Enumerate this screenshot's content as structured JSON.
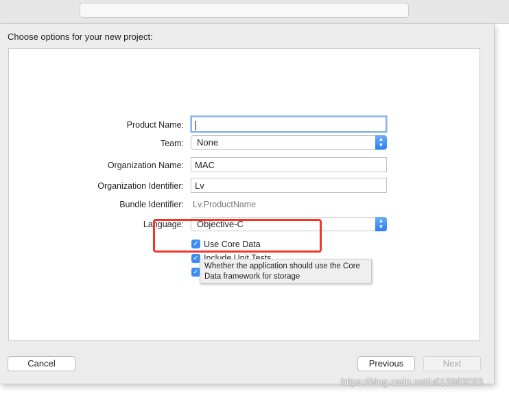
{
  "heading": "Choose options for your new project:",
  "form": {
    "product_name": {
      "label": "Product Name:",
      "value": ""
    },
    "team": {
      "label": "Team:",
      "value": "None"
    },
    "organization_name": {
      "label": "Organization Name:",
      "value": "MAC"
    },
    "organization_identifier": {
      "label": "Organization Identifier:",
      "value": "Lv"
    },
    "bundle_identifier": {
      "label": "Bundle Identifier:",
      "value": "Lv.ProductName"
    },
    "language": {
      "label": "Language:",
      "value": "Objective-C"
    },
    "checkboxes": [
      {
        "label": "Use Core Data",
        "checked": true
      },
      {
        "label": "Include Unit Tests",
        "checked": true
      },
      {
        "label": "",
        "checked": true
      }
    ]
  },
  "tooltip": "Whether the application should use the Core Data framework for storage",
  "buttons": {
    "cancel": "Cancel",
    "previous": "Previous",
    "next": "Next"
  },
  "watermark": "https://blog.csdn.net/u013983033",
  "colors": {
    "accent": "#3b8df5",
    "highlight": "#f4332a"
  }
}
